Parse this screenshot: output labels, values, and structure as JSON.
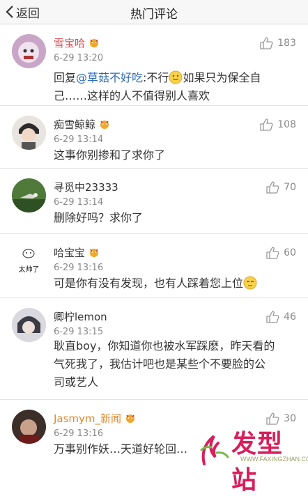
{
  "header": {
    "back_label": "返回",
    "title": "热门评论"
  },
  "comments": [
    {
      "name": "雪宝哈",
      "time": "6-29 13:20",
      "likes": "183",
      "text_prefix": "回复",
      "mention": "@草菇不好吃",
      "text_a": ":不行",
      "text_b": "如果只为保全自",
      "text_c": "己……这样的人不值得别人喜欢"
    },
    {
      "name": "痴雪鲸鲸",
      "time": "6-29 13:14",
      "likes": "108",
      "text": "这事你别掺和了求你了"
    },
    {
      "name": "寻觅中23333",
      "time": "6-29 13:14",
      "likes": "70",
      "text": "删除好吗？求你了"
    },
    {
      "name": "哈宝宝",
      "time": "6-29 13:16",
      "likes": "60",
      "text": "可是你有没有发现，也有人踩着您上位",
      "avatar_text": "太帅了"
    },
    {
      "name": "卿柠lemon",
      "time": "6-29 13:15",
      "likes": "46",
      "line1": "耿直boy，你知道你也被水军踩麽，昨天看的",
      "line2": "气死我了，我估计吧也是某些个不要脸的公",
      "line3": "司或艺人"
    },
    {
      "name": "Jasmym_新闻",
      "time": "6-29 13:16",
      "likes": "30",
      "text": "万事别作妖…天道好轮回…"
    }
  ],
  "watermark": {
    "text": "发型站",
    "url": "WWW.FAXINGZHAN.COM"
  },
  "colors": {
    "accent_link": "#2d6bb3",
    "orange_name": "#e2862b",
    "watermark": "#d81e5b"
  }
}
